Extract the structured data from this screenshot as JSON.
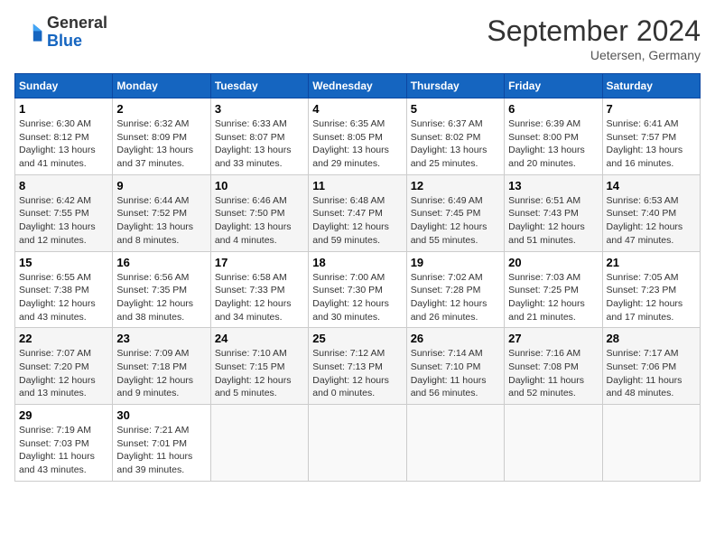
{
  "logo": {
    "general": "General",
    "blue": "Blue"
  },
  "header": {
    "month": "September 2024",
    "location": "Uetersen, Germany"
  },
  "days": [
    "Sunday",
    "Monday",
    "Tuesday",
    "Wednesday",
    "Thursday",
    "Friday",
    "Saturday"
  ],
  "weeks": [
    [
      {
        "day": "1",
        "sunrise": "6:30 AM",
        "sunset": "8:12 PM",
        "daylight": "13 hours and 41 minutes."
      },
      {
        "day": "2",
        "sunrise": "6:32 AM",
        "sunset": "8:09 PM",
        "daylight": "13 hours and 37 minutes."
      },
      {
        "day": "3",
        "sunrise": "6:33 AM",
        "sunset": "8:07 PM",
        "daylight": "13 hours and 33 minutes."
      },
      {
        "day": "4",
        "sunrise": "6:35 AM",
        "sunset": "8:05 PM",
        "daylight": "13 hours and 29 minutes."
      },
      {
        "day": "5",
        "sunrise": "6:37 AM",
        "sunset": "8:02 PM",
        "daylight": "13 hours and 25 minutes."
      },
      {
        "day": "6",
        "sunrise": "6:39 AM",
        "sunset": "8:00 PM",
        "daylight": "13 hours and 20 minutes."
      },
      {
        "day": "7",
        "sunrise": "6:41 AM",
        "sunset": "7:57 PM",
        "daylight": "13 hours and 16 minutes."
      }
    ],
    [
      {
        "day": "8",
        "sunrise": "6:42 AM",
        "sunset": "7:55 PM",
        "daylight": "13 hours and 12 minutes."
      },
      {
        "day": "9",
        "sunrise": "6:44 AM",
        "sunset": "7:52 PM",
        "daylight": "13 hours and 8 minutes."
      },
      {
        "day": "10",
        "sunrise": "6:46 AM",
        "sunset": "7:50 PM",
        "daylight": "13 hours and 4 minutes."
      },
      {
        "day": "11",
        "sunrise": "6:48 AM",
        "sunset": "7:47 PM",
        "daylight": "12 hours and 59 minutes."
      },
      {
        "day": "12",
        "sunrise": "6:49 AM",
        "sunset": "7:45 PM",
        "daylight": "12 hours and 55 minutes."
      },
      {
        "day": "13",
        "sunrise": "6:51 AM",
        "sunset": "7:43 PM",
        "daylight": "12 hours and 51 minutes."
      },
      {
        "day": "14",
        "sunrise": "6:53 AM",
        "sunset": "7:40 PM",
        "daylight": "12 hours and 47 minutes."
      }
    ],
    [
      {
        "day": "15",
        "sunrise": "6:55 AM",
        "sunset": "7:38 PM",
        "daylight": "12 hours and 43 minutes."
      },
      {
        "day": "16",
        "sunrise": "6:56 AM",
        "sunset": "7:35 PM",
        "daylight": "12 hours and 38 minutes."
      },
      {
        "day": "17",
        "sunrise": "6:58 AM",
        "sunset": "7:33 PM",
        "daylight": "12 hours and 34 minutes."
      },
      {
        "day": "18",
        "sunrise": "7:00 AM",
        "sunset": "7:30 PM",
        "daylight": "12 hours and 30 minutes."
      },
      {
        "day": "19",
        "sunrise": "7:02 AM",
        "sunset": "7:28 PM",
        "daylight": "12 hours and 26 minutes."
      },
      {
        "day": "20",
        "sunrise": "7:03 AM",
        "sunset": "7:25 PM",
        "daylight": "12 hours and 21 minutes."
      },
      {
        "day": "21",
        "sunrise": "7:05 AM",
        "sunset": "7:23 PM",
        "daylight": "12 hours and 17 minutes."
      }
    ],
    [
      {
        "day": "22",
        "sunrise": "7:07 AM",
        "sunset": "7:20 PM",
        "daylight": "12 hours and 13 minutes."
      },
      {
        "day": "23",
        "sunrise": "7:09 AM",
        "sunset": "7:18 PM",
        "daylight": "12 hours and 9 minutes."
      },
      {
        "day": "24",
        "sunrise": "7:10 AM",
        "sunset": "7:15 PM",
        "daylight": "12 hours and 5 minutes."
      },
      {
        "day": "25",
        "sunrise": "7:12 AM",
        "sunset": "7:13 PM",
        "daylight": "12 hours and 0 minutes."
      },
      {
        "day": "26",
        "sunrise": "7:14 AM",
        "sunset": "7:10 PM",
        "daylight": "11 hours and 56 minutes."
      },
      {
        "day": "27",
        "sunrise": "7:16 AM",
        "sunset": "7:08 PM",
        "daylight": "11 hours and 52 minutes."
      },
      {
        "day": "28",
        "sunrise": "7:17 AM",
        "sunset": "7:06 PM",
        "daylight": "11 hours and 48 minutes."
      }
    ],
    [
      {
        "day": "29",
        "sunrise": "7:19 AM",
        "sunset": "7:03 PM",
        "daylight": "11 hours and 43 minutes."
      },
      {
        "day": "30",
        "sunrise": "7:21 AM",
        "sunset": "7:01 PM",
        "daylight": "11 hours and 39 minutes."
      },
      null,
      null,
      null,
      null,
      null
    ]
  ]
}
